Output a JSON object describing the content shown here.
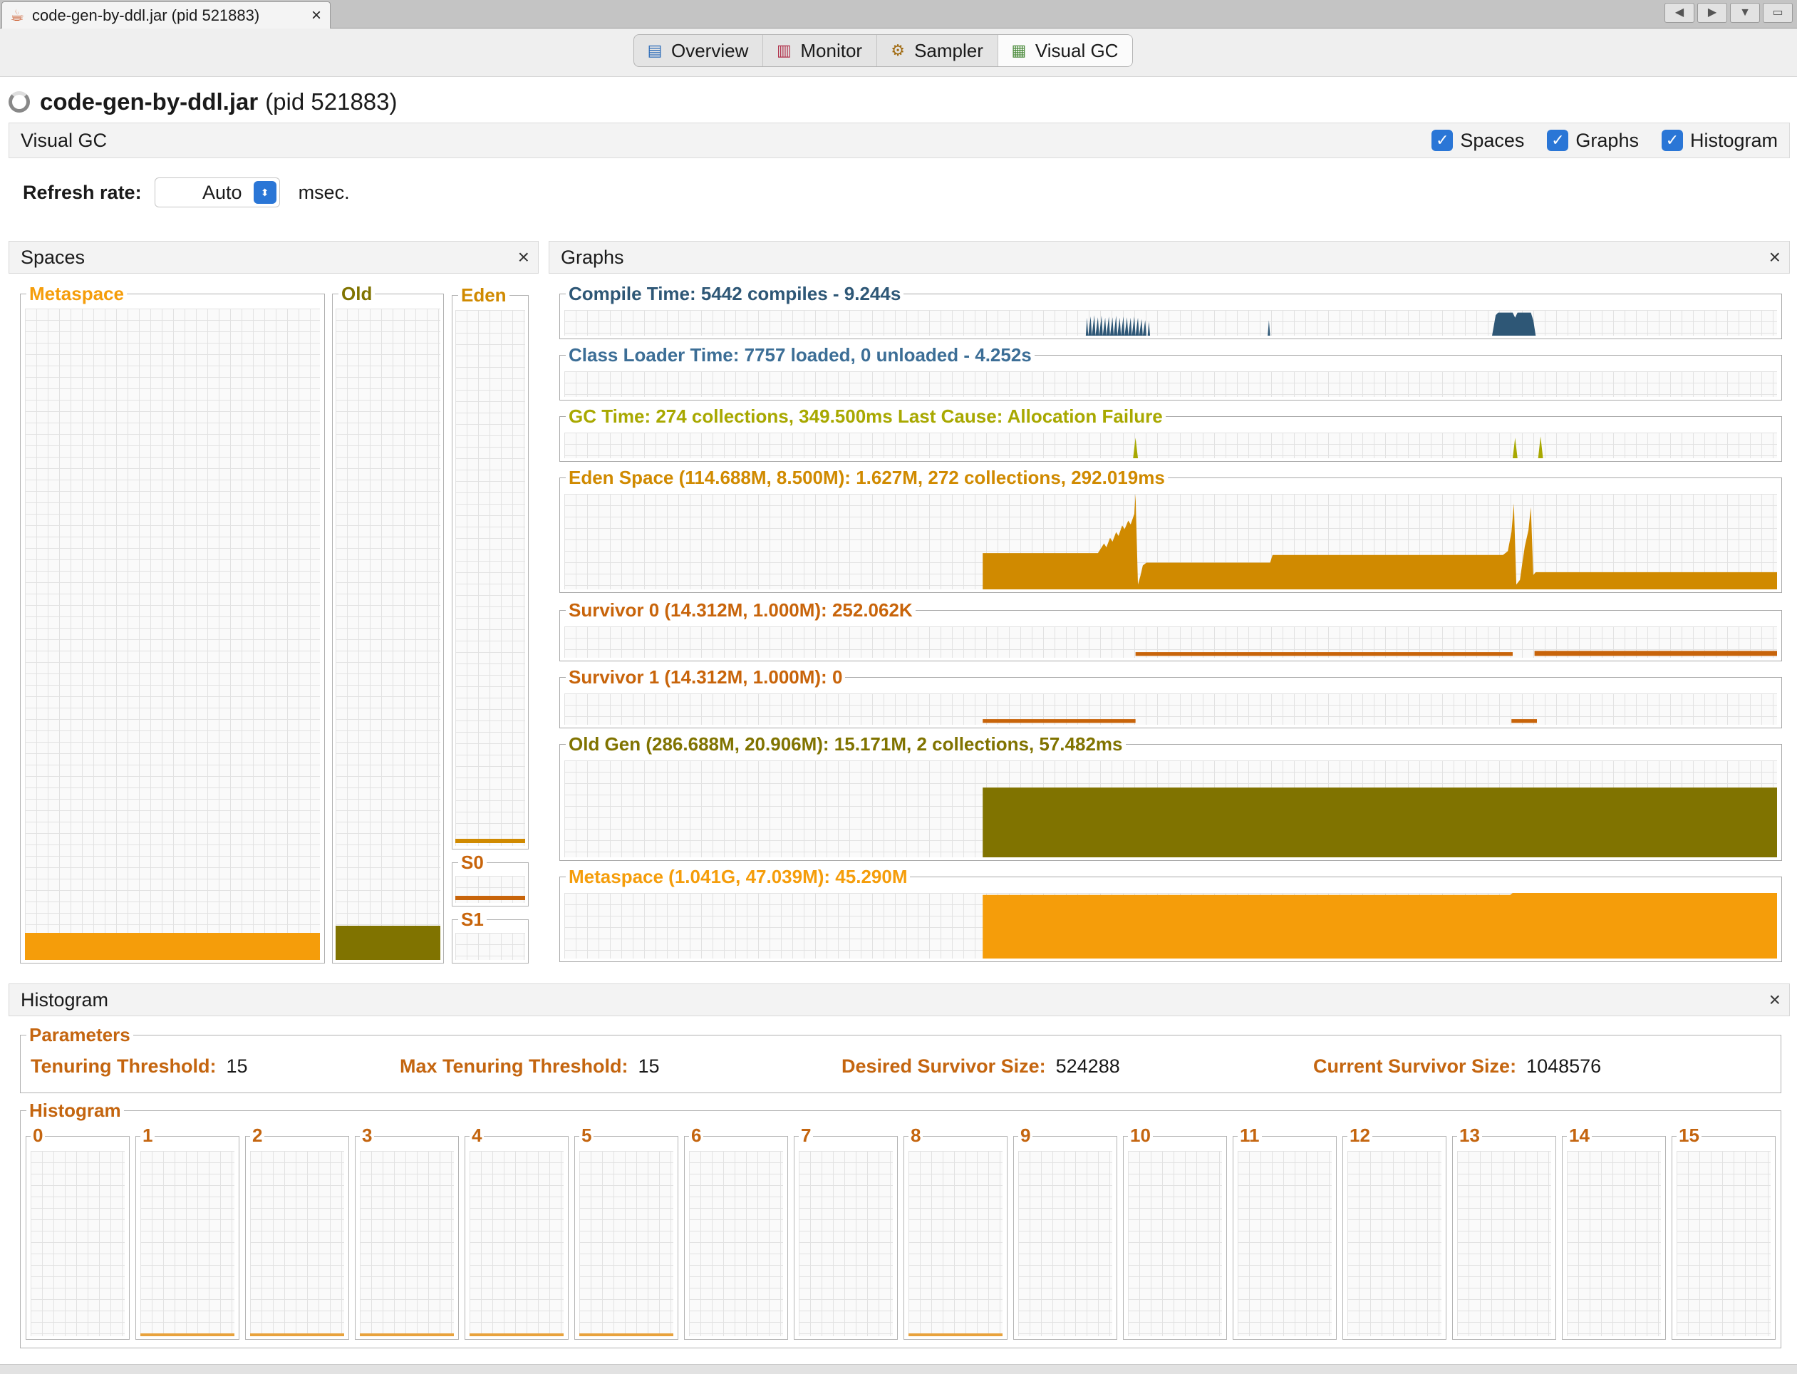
{
  "window": {
    "tab_title": "code-gen-by-ddl.jar (pid 521883)",
    "tab_close": "×"
  },
  "view_tabs": [
    {
      "label": "Overview",
      "icon": "overview-icon",
      "active": false
    },
    {
      "label": "Monitor",
      "icon": "monitor-icon",
      "active": false
    },
    {
      "label": "Sampler",
      "icon": "sampler-icon",
      "active": false
    },
    {
      "label": "Visual GC",
      "icon": "visual-gc-icon",
      "active": true
    }
  ],
  "process": {
    "name": "code-gen-by-ddl.jar",
    "pid": "(pid 521883)"
  },
  "visual_gc": {
    "title": "Visual GC",
    "checkboxes": [
      {
        "label": "Spaces",
        "checked": true
      },
      {
        "label": "Graphs",
        "checked": true
      },
      {
        "label": "Histogram",
        "checked": true
      }
    ]
  },
  "refresh": {
    "label": "Refresh rate:",
    "value": "Auto",
    "unit": "msec."
  },
  "spaces_panel": {
    "title": "Spaces",
    "close": "×",
    "metaspace": {
      "label": "Metaspace",
      "used_fraction": 0.04
    },
    "old": {
      "label": "Old",
      "used_fraction": 0.055
    },
    "eden": {
      "label": "Eden",
      "used_fraction": 0.014
    },
    "s0": {
      "label": "S0",
      "used_fraction": 0.25
    },
    "s1": {
      "label": "S1",
      "used_fraction": 0.0
    }
  },
  "graphs_panel": {
    "title": "Graphs",
    "close": "×",
    "graphs": [
      {
        "label": "Compile Time: 5442 compiles - 9.244s",
        "color": "#2e5776"
      },
      {
        "label": "Class Loader Time: 7757 loaded, 0 unloaded - 4.252s",
        "color": "#3c6e96"
      },
      {
        "label": "GC Time: 274 collections, 349.500ms Last Cause: Allocation Failure",
        "color": "#a8a800"
      },
      {
        "label": "Eden Space (114.688M, 8.500M): 1.627M, 272 collections, 292.019ms",
        "color": "#d08a00"
      },
      {
        "label": "Survivor 0 (14.312M, 1.000M): 252.062K",
        "color": "#c8640a"
      },
      {
        "label": "Survivor 1 (14.312M, 1.000M): 0",
        "color": "#c8640a"
      },
      {
        "label": "Old Gen (286.688M, 20.906M): 15.171M, 2 collections, 57.482ms",
        "color": "#807300"
      },
      {
        "label": "Metaspace (1.041G, 47.039M): 45.290M",
        "color": "#f59d0a"
      }
    ]
  },
  "histogram_panel": {
    "title": "Histogram",
    "close": "×",
    "parameters": {
      "title": "Parameters",
      "items": [
        {
          "label": "Tenuring Threshold:",
          "value": "15"
        },
        {
          "label": "Max Tenuring Threshold:",
          "value": "15"
        },
        {
          "label": "Desired Survivor Size:",
          "value": "524288"
        },
        {
          "label": "Current Survivor Size:",
          "value": "1048576"
        }
      ]
    },
    "histogram": {
      "title": "Histogram",
      "buckets": [
        {
          "label": "0",
          "filled": false
        },
        {
          "label": "1",
          "filled": true
        },
        {
          "label": "2",
          "filled": true
        },
        {
          "label": "3",
          "filled": true
        },
        {
          "label": "4",
          "filled": true
        },
        {
          "label": "5",
          "filled": true
        },
        {
          "label": "6",
          "filled": false
        },
        {
          "label": "7",
          "filled": false
        },
        {
          "label": "8",
          "filled": true
        },
        {
          "label": "9",
          "filled": false
        },
        {
          "label": "10",
          "filled": false
        },
        {
          "label": "11",
          "filled": false
        },
        {
          "label": "12",
          "filled": false
        },
        {
          "label": "13",
          "filled": false
        },
        {
          "label": "14",
          "filled": false
        },
        {
          "label": "15",
          "filled": false
        }
      ]
    }
  },
  "colors": {
    "metaspace": "#f59d0a",
    "old": "#807300",
    "eden": "#d08a00",
    "survivor": "#c8640a",
    "compile": "#2e5776",
    "gc": "#a8a800",
    "label_orange": "#c4650f",
    "check_blue": "#2a76d6"
  }
}
